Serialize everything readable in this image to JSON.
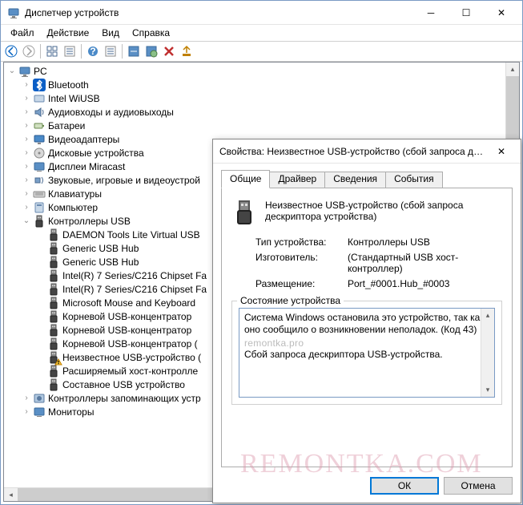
{
  "main": {
    "title": "Диспетчер устройств",
    "menu": {
      "file": "Файл",
      "action": "Действие",
      "view": "Вид",
      "help": "Справка"
    }
  },
  "tree": {
    "root": "PC",
    "nodes": [
      {
        "label": "Bluetooth",
        "twisty": ">",
        "indent": 1,
        "icon": "bluetooth"
      },
      {
        "label": "Intel WiUSB",
        "twisty": ">",
        "indent": 1,
        "icon": "wiusb"
      },
      {
        "label": "Аудиовходы и аудиовыходы",
        "twisty": ">",
        "indent": 1,
        "icon": "audio"
      },
      {
        "label": "Батареи",
        "twisty": ">",
        "indent": 1,
        "icon": "battery"
      },
      {
        "label": "Видеоадаптеры",
        "twisty": ">",
        "indent": 1,
        "icon": "display"
      },
      {
        "label": "Дисковые устройства",
        "twisty": ">",
        "indent": 1,
        "icon": "disk"
      },
      {
        "label": "Дисплеи Miracast",
        "twisty": ">",
        "indent": 1,
        "icon": "monitor"
      },
      {
        "label": "Звуковые, игровые и видеоустрой",
        "twisty": ">",
        "indent": 1,
        "icon": "sound"
      },
      {
        "label": "Клавиатуры",
        "twisty": ">",
        "indent": 1,
        "icon": "keyboard"
      },
      {
        "label": "Компьютер",
        "twisty": ">",
        "indent": 1,
        "icon": "computer"
      },
      {
        "label": "Контроллеры USB",
        "twisty": "v",
        "indent": 1,
        "icon": "usb"
      },
      {
        "label": "DAEMON Tools Lite Virtual USB",
        "twisty": "",
        "indent": 2,
        "icon": "usb"
      },
      {
        "label": "Generic USB Hub",
        "twisty": "",
        "indent": 2,
        "icon": "usb"
      },
      {
        "label": "Generic USB Hub",
        "twisty": "",
        "indent": 2,
        "icon": "usb"
      },
      {
        "label": "Intel(R) 7 Series/C216 Chipset Fa",
        "twisty": "",
        "indent": 2,
        "icon": "usb"
      },
      {
        "label": "Intel(R) 7 Series/C216 Chipset Fa",
        "twisty": "",
        "indent": 2,
        "icon": "usb"
      },
      {
        "label": "Microsoft Mouse and Keyboard",
        "twisty": "",
        "indent": 2,
        "icon": "usb"
      },
      {
        "label": "Корневой USB-концентратор",
        "twisty": "",
        "indent": 2,
        "icon": "usb"
      },
      {
        "label": "Корневой USB-концентратор",
        "twisty": "",
        "indent": 2,
        "icon": "usb"
      },
      {
        "label": "Корневой USB-концентратор (",
        "twisty": "",
        "indent": 2,
        "icon": "usb"
      },
      {
        "label": "Неизвестное USB-устройство (",
        "twisty": "",
        "indent": 2,
        "icon": "usb",
        "warn": true
      },
      {
        "label": "Расширяемый хост-контролле",
        "twisty": "",
        "indent": 2,
        "icon": "usb"
      },
      {
        "label": "Составное USB устройство",
        "twisty": "",
        "indent": 2,
        "icon": "usb"
      },
      {
        "label": "Контроллеры запоминающих устр",
        "twisty": ">",
        "indent": 1,
        "icon": "storage"
      },
      {
        "label": "Мониторы",
        "twisty": ">",
        "indent": 1,
        "icon": "monitor"
      }
    ]
  },
  "dialog": {
    "title": "Свойства: Неизвестное USB-устройство (сбой запроса дескрип...",
    "tabs": {
      "general": "Общие",
      "driver": "Драйвер",
      "details": "Сведения",
      "events": "События"
    },
    "deviceName": "Неизвестное USB-устройство (сбой запроса дескриптора устройства)",
    "props": {
      "typeLabel": "Тип устройства:",
      "typeValue": "Контроллеры USB",
      "mfrLabel": "Изготовитель:",
      "mfrValue": "(Стандартный USB хост-контроллер)",
      "locLabel": "Размещение:",
      "locValue": "Port_#0001.Hub_#0003"
    },
    "statusLegend": "Состояние устройства",
    "statusLine1": "Система Windows остановила это устройство, так как оно сообщило о возникновении неполадок. (Код 43)",
    "statusWm": "remontka.pro",
    "statusLine2": "Сбой запроса дескриптора USB-устройства.",
    "ok": "ОК",
    "cancel": "Отмена"
  },
  "watermark": "REMONTKA.COM"
}
